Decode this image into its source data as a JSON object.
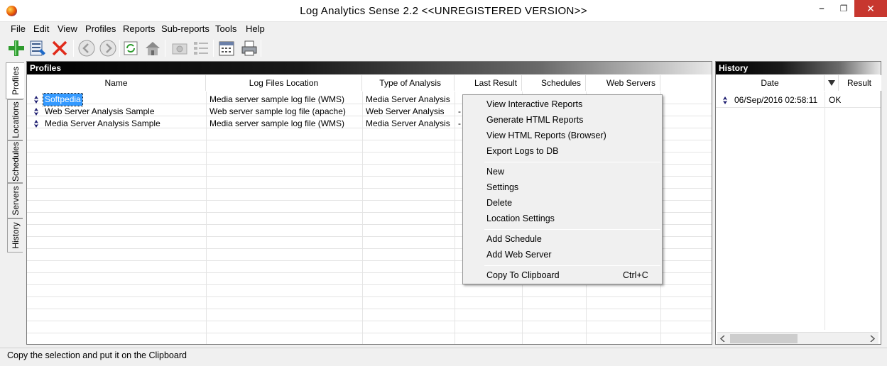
{
  "window": {
    "title": "Log Analytics Sense 2.2 <<UNREGISTERED VERSION>>"
  },
  "menu": [
    "File",
    "Edit",
    "View",
    "Profiles",
    "Reports",
    "Sub-reports",
    "Tools",
    "Help"
  ],
  "toolbar": {
    "buttons": [
      "add-icon",
      "properties-icon",
      "delete-icon",
      "back-icon",
      "forward-icon",
      "refresh-icon",
      "home-icon",
      "snapshot-icon",
      "list-icon",
      "calendar-icon",
      "print-icon"
    ]
  },
  "side_tabs": [
    "Profiles",
    "Locations",
    "Schedules",
    "Servers",
    "History"
  ],
  "profiles": {
    "header": "Profiles",
    "columns": [
      "Name",
      "Log Files Location",
      "Type of Analysis",
      "Last Result",
      "Schedules",
      "Web Servers"
    ],
    "rows": [
      {
        "name": "Softpedia",
        "location": "Media server sample log file (WMS)",
        "type": "Media Server Analysis",
        "last_result": "",
        "selected": true
      },
      {
        "name": "Web Server Analysis Sample",
        "location": "Web server sample log file (apache)",
        "type": "Web Server Analysis",
        "last_result": "-",
        "selected": false
      },
      {
        "name": "Media Server Analysis Sample",
        "location": "Media server sample log file (WMS)",
        "type": "Media Server Analysis",
        "last_result": "-",
        "selected": false
      }
    ]
  },
  "history": {
    "header": "History",
    "columns": [
      "Date",
      "Result"
    ],
    "sort_icon": "sort-descending-icon",
    "rows": [
      {
        "date": "06/Sep/2016 02:58:11",
        "result": "OK"
      }
    ]
  },
  "context_menu": {
    "groups": [
      [
        "View Interactive Reports",
        "Generate HTML Reports",
        "View HTML Reports (Browser)",
        "Export Logs to DB"
      ],
      [
        "New",
        "Settings",
        "Delete",
        "Location Settings"
      ],
      [
        "Add Schedule",
        "Add Web Server"
      ],
      [
        "Copy To Clipboard"
      ]
    ],
    "shortcut": "Ctrl+C"
  },
  "status": {
    "text": "Copy the selection and put it on the Clipboard"
  }
}
